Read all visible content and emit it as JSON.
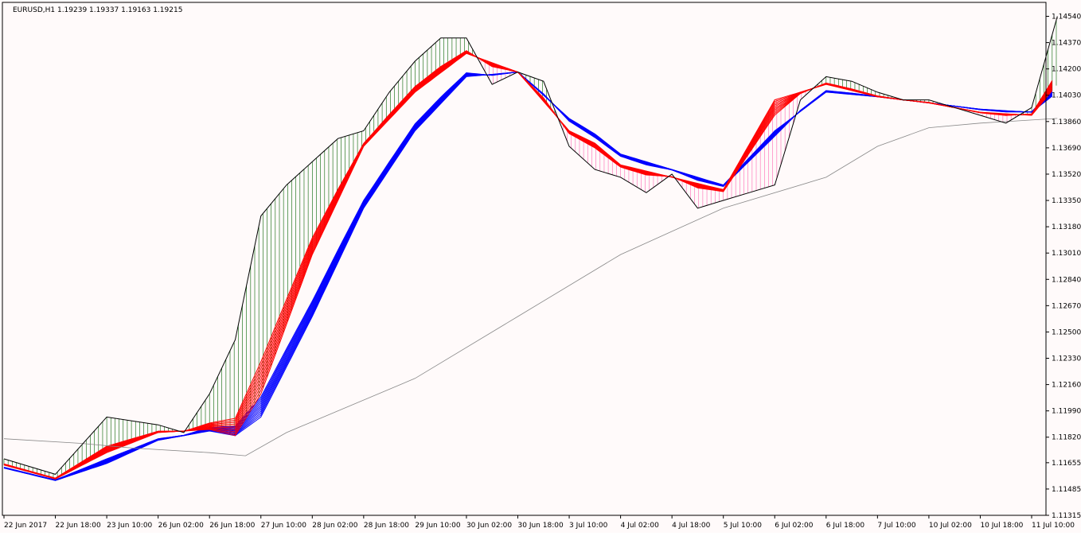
{
  "chart": {
    "header": "EURUSD,H1  1.19239 1.19337 1.19163 1.19215"
  },
  "colors": {
    "background": "#fffafa",
    "frame": "#000000",
    "price": "#000000",
    "ma_slow": "#888888",
    "fast_group": "#ff0000",
    "slow_group": "#0000ff",
    "histogram_bull": "#006400",
    "histogram_bear": "#ff69b4"
  },
  "chart_data": {
    "type": "line",
    "symbol": "EURUSD",
    "timeframe": "H1",
    "ohlc": {
      "open": 1.19239,
      "high": 1.19337,
      "low": 1.19163,
      "close": 1.19215
    },
    "ylim": [
      1.11315,
      1.1463
    ],
    "y_ticks": [
      "1.14540",
      "1.14370",
      "1.14200",
      "1.14030",
      "1.13860",
      "1.13690",
      "1.13520",
      "1.13350",
      "1.13180",
      "1.13010",
      "1.12840",
      "1.12670",
      "1.12500",
      "1.12330",
      "1.12160",
      "1.11990",
      "1.11820",
      "1.11655",
      "1.11485",
      "1.11315"
    ],
    "x_ticks": [
      "22 Jun 2017",
      "22 Jun 18:00",
      "23 Jun 10:00",
      "26 Jun 02:00",
      "26 Jun 18:00",
      "27 Jun 10:00",
      "28 Jun 02:00",
      "28 Jun 18:00",
      "29 Jun 10:00",
      "30 Jun 02:00",
      "30 Jun 18:00",
      "3 Jul 10:00",
      "4 Jul 02:00",
      "4 Jul 18:00",
      "5 Jul 10:00",
      "6 Jul 02:00",
      "6 Jul 18:00",
      "7 Jul 10:00",
      "10 Jul 02:00",
      "10 Jul 18:00",
      "11 Jul 10:00"
    ],
    "grid": false,
    "legend": "none",
    "series": [
      {
        "key": "price",
        "type": "line",
        "x": [
          0,
          1,
          2,
          3,
          3.5,
          4,
          4.5,
          5,
          5.5,
          6,
          6.5,
          7,
          7.5,
          8,
          8.5,
          9,
          9.5,
          10,
          10.5,
          11,
          11.5,
          12,
          12.5,
          13,
          13.5,
          14,
          14.5,
          15,
          15.5,
          16,
          16.5,
          17,
          17.5,
          18,
          18.5,
          19,
          19.5,
          20,
          20.5
        ],
        "values": [
          1.1168,
          1.1158,
          1.1195,
          1.119,
          1.1185,
          1.121,
          1.1245,
          1.1325,
          1.1345,
          1.136,
          1.1375,
          1.138,
          1.1405,
          1.1425,
          1.144,
          1.144,
          1.141,
          1.1418,
          1.1412,
          1.137,
          1.1355,
          1.135,
          1.134,
          1.1352,
          1.133,
          1.1335,
          1.134,
          1.1345,
          1.14,
          1.1415,
          1.1412,
          1.1405,
          1.14,
          1.14,
          1.1395,
          1.139,
          1.1385,
          1.1395,
          1.1454
        ]
      },
      {
        "key": "ma_slow",
        "type": "line",
        "x": [
          0,
          1.5,
          2.5,
          4,
          4.7,
          5.5,
          8,
          10,
          12,
          14,
          16,
          17,
          18,
          19,
          20,
          20.5
        ],
        "values": [
          1.1181,
          1.1178,
          1.1175,
          1.1172,
          1.117,
          1.1185,
          1.122,
          1.126,
          1.13,
          1.133,
          1.135,
          1.137,
          1.1382,
          1.1385,
          1.1387,
          1.1388
        ]
      },
      {
        "key": "fast_group",
        "type": "line",
        "x": [
          0,
          1,
          2,
          3,
          4,
          4.5,
          5,
          6,
          7,
          8,
          9,
          10,
          11,
          11.5,
          12,
          13,
          14,
          15,
          16,
          17,
          18,
          19,
          20,
          20.5
        ],
        "values": [
          1.1164,
          1.1155,
          1.1172,
          1.1185,
          1.1187,
          1.1183,
          1.121,
          1.13,
          1.137,
          1.1405,
          1.143,
          1.1418,
          1.138,
          1.1372,
          1.1358,
          1.135,
          1.1342,
          1.14,
          1.141,
          1.1402,
          1.1398,
          1.1392,
          1.139,
          1.141
        ]
      },
      {
        "key": "slow_group",
        "type": "line",
        "x": [
          0,
          1,
          2,
          3,
          4,
          4.5,
          5,
          6,
          7,
          8,
          9,
          10,
          11,
          11.5,
          12,
          13,
          14,
          15,
          16,
          17,
          18,
          19,
          20,
          20.5
        ],
        "values": [
          1.1162,
          1.1154,
          1.1165,
          1.118,
          1.1186,
          1.1183,
          1.1195,
          1.126,
          1.133,
          1.138,
          1.1415,
          1.1418,
          1.1388,
          1.1378,
          1.1365,
          1.1355,
          1.1345,
          1.138,
          1.1405,
          1.1402,
          1.1398,
          1.1394,
          1.1392,
          1.1405
        ]
      }
    ]
  }
}
